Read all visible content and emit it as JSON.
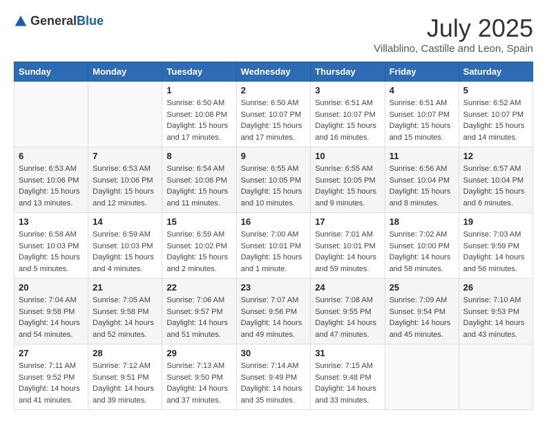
{
  "header": {
    "logo_general": "General",
    "logo_blue": "Blue",
    "month_title": "July 2025",
    "subtitle": "Villablino, Castille and Leon, Spain"
  },
  "days_of_week": [
    "Sunday",
    "Monday",
    "Tuesday",
    "Wednesday",
    "Thursday",
    "Friday",
    "Saturday"
  ],
  "weeks": [
    [
      {
        "day": "",
        "info": ""
      },
      {
        "day": "",
        "info": ""
      },
      {
        "day": "1",
        "info": "Sunrise: 6:50 AM\nSunset: 10:08 PM\nDaylight: 15 hours\nand 17 minutes."
      },
      {
        "day": "2",
        "info": "Sunrise: 6:50 AM\nSunset: 10:07 PM\nDaylight: 15 hours\nand 17 minutes."
      },
      {
        "day": "3",
        "info": "Sunrise: 6:51 AM\nSunset: 10:07 PM\nDaylight: 15 hours\nand 16 minutes."
      },
      {
        "day": "4",
        "info": "Sunrise: 6:51 AM\nSunset: 10:07 PM\nDaylight: 15 hours\nand 15 minutes."
      },
      {
        "day": "5",
        "info": "Sunrise: 6:52 AM\nSunset: 10:07 PM\nDaylight: 15 hours\nand 14 minutes."
      }
    ],
    [
      {
        "day": "6",
        "info": "Sunrise: 6:53 AM\nSunset: 10:06 PM\nDaylight: 15 hours\nand 13 minutes."
      },
      {
        "day": "7",
        "info": "Sunrise: 6:53 AM\nSunset: 10:06 PM\nDaylight: 15 hours\nand 12 minutes."
      },
      {
        "day": "8",
        "info": "Sunrise: 6:54 AM\nSunset: 10:06 PM\nDaylight: 15 hours\nand 11 minutes."
      },
      {
        "day": "9",
        "info": "Sunrise: 6:55 AM\nSunset: 10:05 PM\nDaylight: 15 hours\nand 10 minutes."
      },
      {
        "day": "10",
        "info": "Sunrise: 6:55 AM\nSunset: 10:05 PM\nDaylight: 15 hours\nand 9 minutes."
      },
      {
        "day": "11",
        "info": "Sunrise: 6:56 AM\nSunset: 10:04 PM\nDaylight: 15 hours\nand 8 minutes."
      },
      {
        "day": "12",
        "info": "Sunrise: 6:57 AM\nSunset: 10:04 PM\nDaylight: 15 hours\nand 6 minutes."
      }
    ],
    [
      {
        "day": "13",
        "info": "Sunrise: 6:58 AM\nSunset: 10:03 PM\nDaylight: 15 hours\nand 5 minutes."
      },
      {
        "day": "14",
        "info": "Sunrise: 6:59 AM\nSunset: 10:03 PM\nDaylight: 15 hours\nand 4 minutes."
      },
      {
        "day": "15",
        "info": "Sunrise: 6:59 AM\nSunset: 10:02 PM\nDaylight: 15 hours\nand 2 minutes."
      },
      {
        "day": "16",
        "info": "Sunrise: 7:00 AM\nSunset: 10:01 PM\nDaylight: 15 hours\nand 1 minute."
      },
      {
        "day": "17",
        "info": "Sunrise: 7:01 AM\nSunset: 10:01 PM\nDaylight: 14 hours\nand 59 minutes."
      },
      {
        "day": "18",
        "info": "Sunrise: 7:02 AM\nSunset: 10:00 PM\nDaylight: 14 hours\nand 58 minutes."
      },
      {
        "day": "19",
        "info": "Sunrise: 7:03 AM\nSunset: 9:59 PM\nDaylight: 14 hours\nand 56 minutes."
      }
    ],
    [
      {
        "day": "20",
        "info": "Sunrise: 7:04 AM\nSunset: 9:58 PM\nDaylight: 14 hours\nand 54 minutes."
      },
      {
        "day": "21",
        "info": "Sunrise: 7:05 AM\nSunset: 9:58 PM\nDaylight: 14 hours\nand 52 minutes."
      },
      {
        "day": "22",
        "info": "Sunrise: 7:06 AM\nSunset: 9:57 PM\nDaylight: 14 hours\nand 51 minutes."
      },
      {
        "day": "23",
        "info": "Sunrise: 7:07 AM\nSunset: 9:56 PM\nDaylight: 14 hours\nand 49 minutes."
      },
      {
        "day": "24",
        "info": "Sunrise: 7:08 AM\nSunset: 9:55 PM\nDaylight: 14 hours\nand 47 minutes."
      },
      {
        "day": "25",
        "info": "Sunrise: 7:09 AM\nSunset: 9:54 PM\nDaylight: 14 hours\nand 45 minutes."
      },
      {
        "day": "26",
        "info": "Sunrise: 7:10 AM\nSunset: 9:53 PM\nDaylight: 14 hours\nand 43 minutes."
      }
    ],
    [
      {
        "day": "27",
        "info": "Sunrise: 7:11 AM\nSunset: 9:52 PM\nDaylight: 14 hours\nand 41 minutes."
      },
      {
        "day": "28",
        "info": "Sunrise: 7:12 AM\nSunset: 9:51 PM\nDaylight: 14 hours\nand 39 minutes."
      },
      {
        "day": "29",
        "info": "Sunrise: 7:13 AM\nSunset: 9:50 PM\nDaylight: 14 hours\nand 37 minutes."
      },
      {
        "day": "30",
        "info": "Sunrise: 7:14 AM\nSunset: 9:49 PM\nDaylight: 14 hours\nand 35 minutes."
      },
      {
        "day": "31",
        "info": "Sunrise: 7:15 AM\nSunset: 9:48 PM\nDaylight: 14 hours\nand 33 minutes."
      },
      {
        "day": "",
        "info": ""
      },
      {
        "day": "",
        "info": ""
      }
    ]
  ]
}
